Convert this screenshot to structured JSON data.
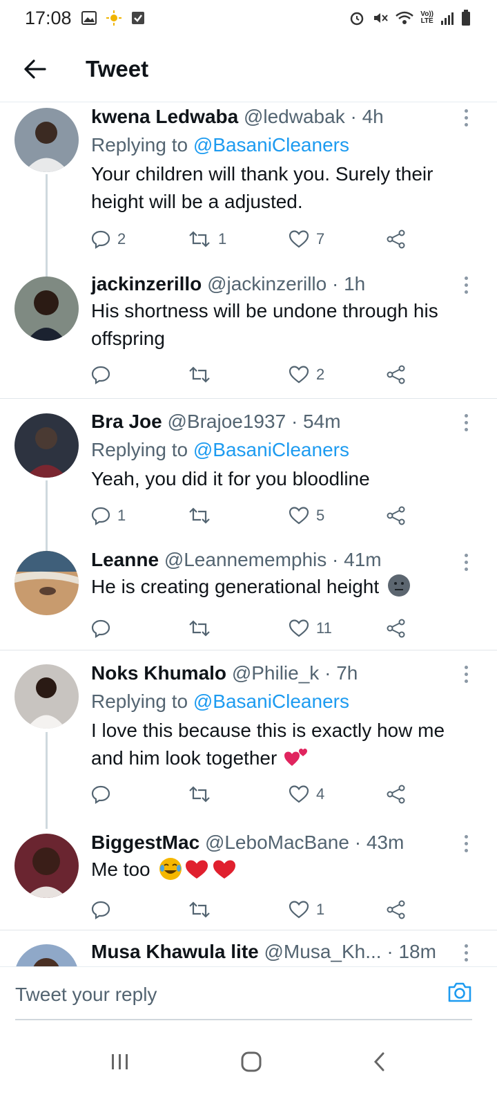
{
  "status_bar": {
    "time": "17:08",
    "lte_top": "Vo))",
    "lte_bottom": "LTE"
  },
  "header": {
    "title": "Tweet"
  },
  "tweets": [
    {
      "name": "kwena Ledwaba",
      "handle": "@ledwabak",
      "time": "4h",
      "replying_prefix": "Replying to",
      "replying_to": "@BasaniCleaners",
      "text": "Your children will thank you. Surely their height will be a adjusted.",
      "replies": "2",
      "retweets": "1",
      "likes": "7",
      "avatar_color": "#6b7a8a"
    },
    {
      "name": "jackinzerillo",
      "handle": "@jackinzerillo",
      "time": "1h",
      "text": "His shortness will be undone through his offspring",
      "replies": "",
      "retweets": "",
      "likes": "2",
      "avatar_color": "#5d6b63"
    },
    {
      "name": "Bra Joe",
      "handle": "@Brajoe1937",
      "time": "54m",
      "replying_prefix": "Replying to",
      "replying_to": "@BasaniCleaners",
      "text": "Yeah, you did it for you bloodline",
      "replies": "1",
      "retweets": "",
      "likes": "5",
      "avatar_color": "#3a4150"
    },
    {
      "name": "Leanne",
      "handle": "@Leannememphis",
      "time": "41m",
      "text": "He is creating generational height",
      "emoji": "neutral-face",
      "replies": "",
      "retweets": "",
      "likes": "11",
      "avatar_color": "#c9a37c"
    },
    {
      "name": "Noks Khumalo",
      "handle": "@Philie_k",
      "time": "7h",
      "replying_prefix": "Replying to",
      "replying_to": "@BasaniCleaners",
      "text": "I love this because this is exactly how me and him look together",
      "emoji": "two-hearts",
      "replies": "",
      "retweets": "",
      "likes": "4",
      "avatar_color": "#d9d3cf"
    },
    {
      "name": "BiggestMac",
      "handle": "@LeboMacBane",
      "time": "43m",
      "text": "Me too",
      "emoji": "joy-hearts",
      "replies": "",
      "retweets": "",
      "likes": "1",
      "avatar_color": "#7a2f3a"
    },
    {
      "name": "Musa Khawula lite",
      "handle": "@Musa_Kh...",
      "time": "18m",
      "avatar_color": "#4a5a80"
    }
  ],
  "composer": {
    "placeholder": "Tweet your reply"
  },
  "colors": {
    "accent": "#1d9bf0",
    "muted": "#536471",
    "like_heart": "#e0245e"
  }
}
